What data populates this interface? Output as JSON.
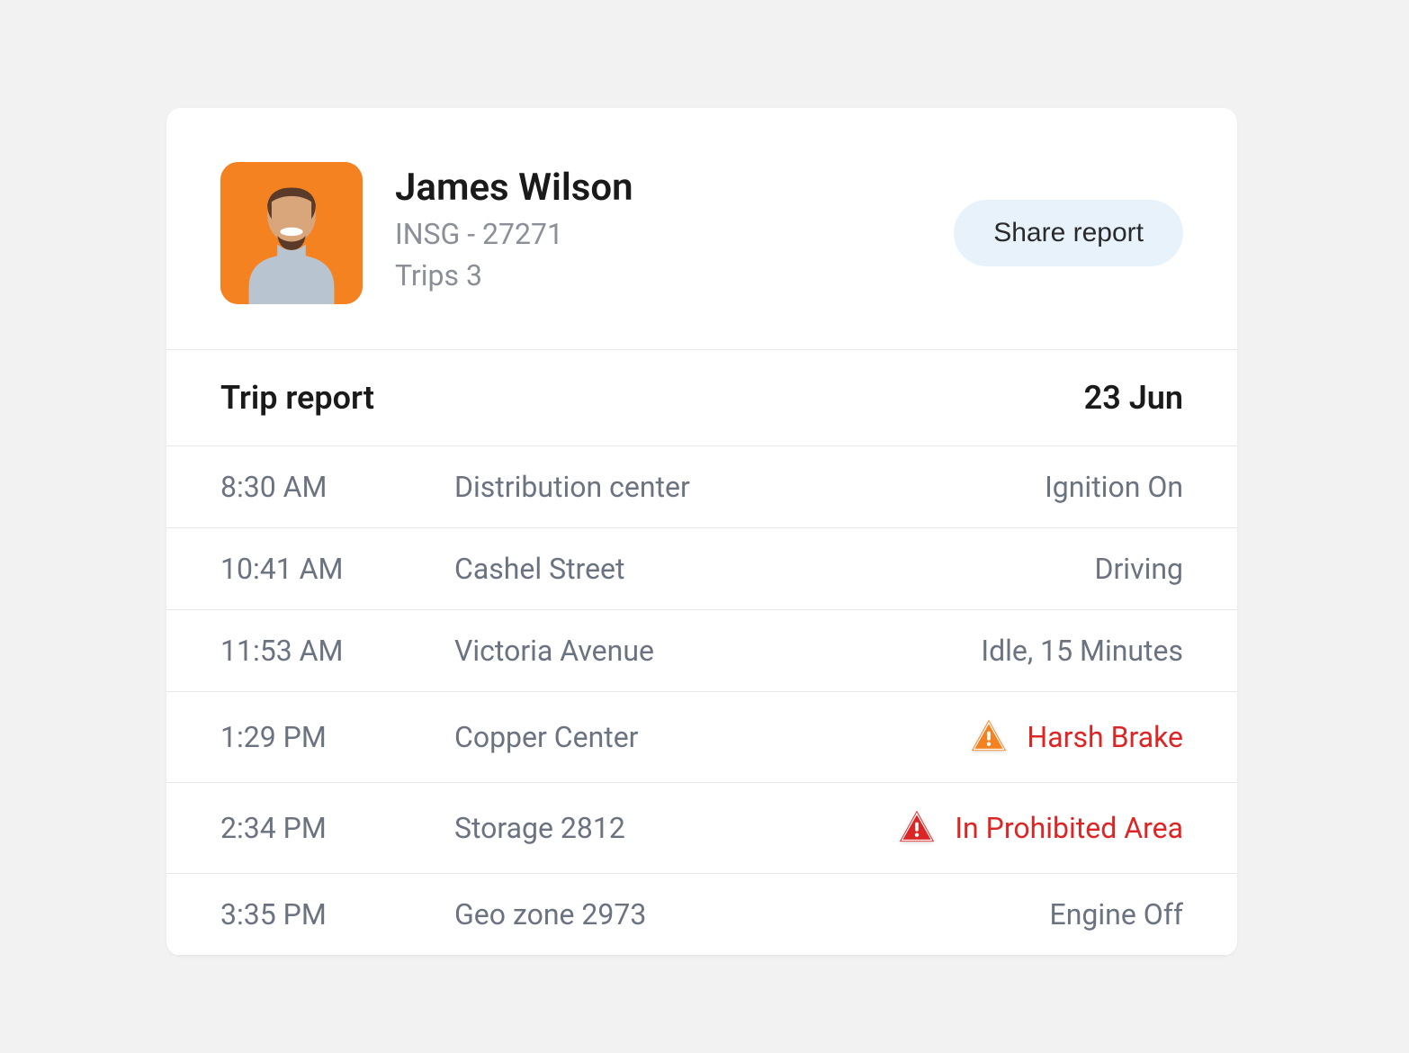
{
  "driver": {
    "name": "James Wilson",
    "vehicle_id": "INSG - 27271",
    "trips_label": "Trips 3"
  },
  "share_button": "Share report",
  "report": {
    "title": "Trip report",
    "date": "23 Jun",
    "rows": [
      {
        "time": "8:30 AM",
        "location": "Distribution center",
        "status": "Ignition On",
        "alert": false,
        "severity": null
      },
      {
        "time": "10:41 AM",
        "location": "Cashel Street",
        "status": "Driving",
        "alert": false,
        "severity": null
      },
      {
        "time": "11:53 AM",
        "location": "Victoria Avenue",
        "status": "Idle, 15 Minutes",
        "alert": false,
        "severity": null
      },
      {
        "time": "1:29 PM",
        "location": "Copper Center",
        "status": "Harsh Brake",
        "alert": true,
        "severity": "warning"
      },
      {
        "time": "2:34 PM",
        "location": "Storage 2812",
        "status": "In Prohibited Area",
        "alert": true,
        "severity": "danger"
      },
      {
        "time": "3:35 PM",
        "location": "Geo zone 2973",
        "status": "Engine Off",
        "alert": false,
        "severity": null
      }
    ]
  },
  "colors": {
    "warning": "#f58220",
    "danger": "#dc2626"
  }
}
